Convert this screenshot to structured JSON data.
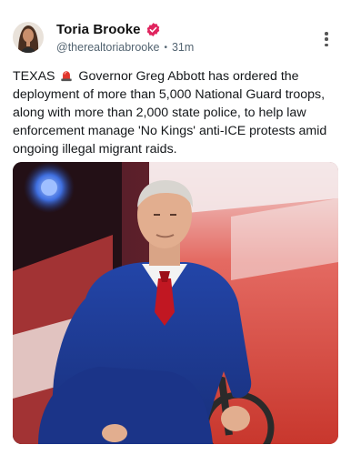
{
  "author": {
    "display_name": "Toria Brooke",
    "handle": "@therealtoriabrooke",
    "timestamp": "31m",
    "verified_badge_color": "#e0245e"
  },
  "post": {
    "text_prefix": "TEXAS",
    "emoji": "siren-icon",
    "text_main": " Governor Greg Abbott has ordered the deployment of more than 5,000 National Guard troops, along with more than 2,000 state police, to help law enforcement manage 'No Kings' anti-ICE protests amid ongoing illegal migrant raids."
  },
  "icons": {
    "more": "vertical-ellipsis-icon",
    "verified": "verified-badge-icon"
  },
  "media": {
    "type": "photo",
    "description_icon": "photo-image"
  }
}
